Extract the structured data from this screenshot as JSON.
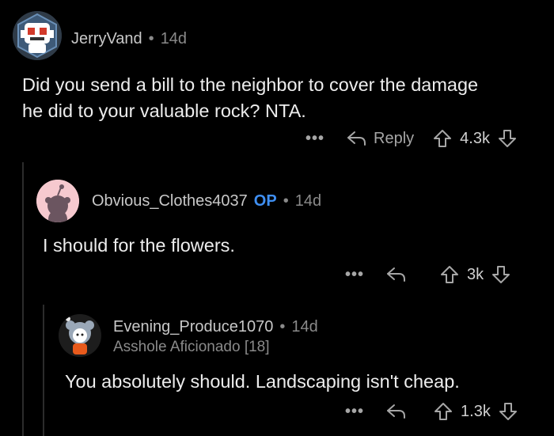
{
  "comments": [
    {
      "username": "JerryVand",
      "separator": "•",
      "time": "14d",
      "body_line1": "Did you send a bill to the neighbor to cover the damage",
      "body_line2": "he did to your valuable rock? NTA.",
      "more": "•••",
      "reply_label": "Reply",
      "score": "4.3k"
    },
    {
      "username": "Obvious_Clothes4037",
      "op_badge": "OP",
      "separator": "•",
      "time": "14d",
      "body": "I should for the flowers.",
      "more": "•••",
      "score": "3k"
    },
    {
      "username": "Evening_Produce1070",
      "separator": "•",
      "time": "14d",
      "flair": "Asshole Aficionado [18]",
      "body": "You absolutely should. Landscaping isn't cheap.",
      "more": "•••",
      "score": "1.3k"
    }
  ],
  "icons": {
    "reply": "reply-arrow-icon",
    "upvote": "upvote-arrow-icon",
    "downvote": "downvote-arrow-icon"
  },
  "colors": {
    "background": "#000000",
    "op_badge": "#3f8ff2",
    "avatar2_bg": "#f6c9cf"
  }
}
